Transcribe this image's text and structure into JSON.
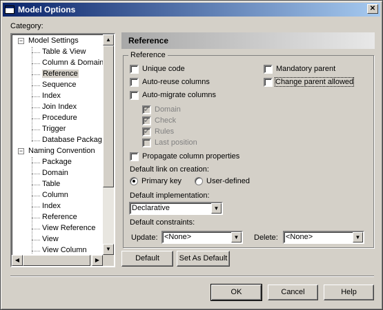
{
  "window": {
    "title": "Model Options"
  },
  "category_label": "Category:",
  "tree": [
    {
      "label": "Model Settings",
      "level": 0,
      "expander": "−"
    },
    {
      "label": "Table & View",
      "level": 1
    },
    {
      "label": "Column & Domain",
      "level": 1
    },
    {
      "label": "Reference",
      "level": 1,
      "selected": true
    },
    {
      "label": "Sequence",
      "level": 1
    },
    {
      "label": "Index",
      "level": 1
    },
    {
      "label": "Join Index",
      "level": 1
    },
    {
      "label": "Procedure",
      "level": 1
    },
    {
      "label": "Trigger",
      "level": 1
    },
    {
      "label": "Database Packag",
      "level": 1
    },
    {
      "label": "Naming Convention",
      "level": 0,
      "expander": "−"
    },
    {
      "label": "Package",
      "level": 1
    },
    {
      "label": "Domain",
      "level": 1
    },
    {
      "label": "Table",
      "level": 1
    },
    {
      "label": "Column",
      "level": 1
    },
    {
      "label": "Index",
      "level": 1
    },
    {
      "label": "Reference",
      "level": 1
    },
    {
      "label": "View Reference",
      "level": 1
    },
    {
      "label": "View",
      "level": 1
    },
    {
      "label": "View Column",
      "level": 1
    }
  ],
  "panel": {
    "header": "Reference",
    "group_title": "Reference",
    "unique_code": "Unique code",
    "auto_reuse": "Auto-reuse columns",
    "auto_migrate": "Auto-migrate columns",
    "domain": "Domain",
    "check": "Check",
    "rules": "Rules",
    "last_position": "Last position",
    "mandatory_parent": "Mandatory parent",
    "change_parent": "Change parent allowed",
    "propagate": "Propagate column properties",
    "default_link_label": "Default link on creation:",
    "primary_key": "Primary key",
    "user_defined": "User-defined",
    "default_impl_label": "Default implementation:",
    "default_impl_value": "Declarative",
    "default_constraints_label": "Default constraints:",
    "update_label": "Update:",
    "update_value": "<None>",
    "delete_label": "Delete:",
    "delete_value": "<None>"
  },
  "buttons": {
    "default": "Default",
    "set_as_default": "Set As Default",
    "ok": "OK",
    "cancel": "Cancel",
    "help": "Help"
  },
  "glyphs": {
    "check": "✔",
    "down": "▼",
    "up": "▲",
    "left": "◀",
    "right": "▶",
    "close": "✕"
  },
  "colors": {
    "titlebar_start": "#0a246a",
    "titlebar_end": "#a6caf0",
    "face": "#d4d0c8"
  }
}
